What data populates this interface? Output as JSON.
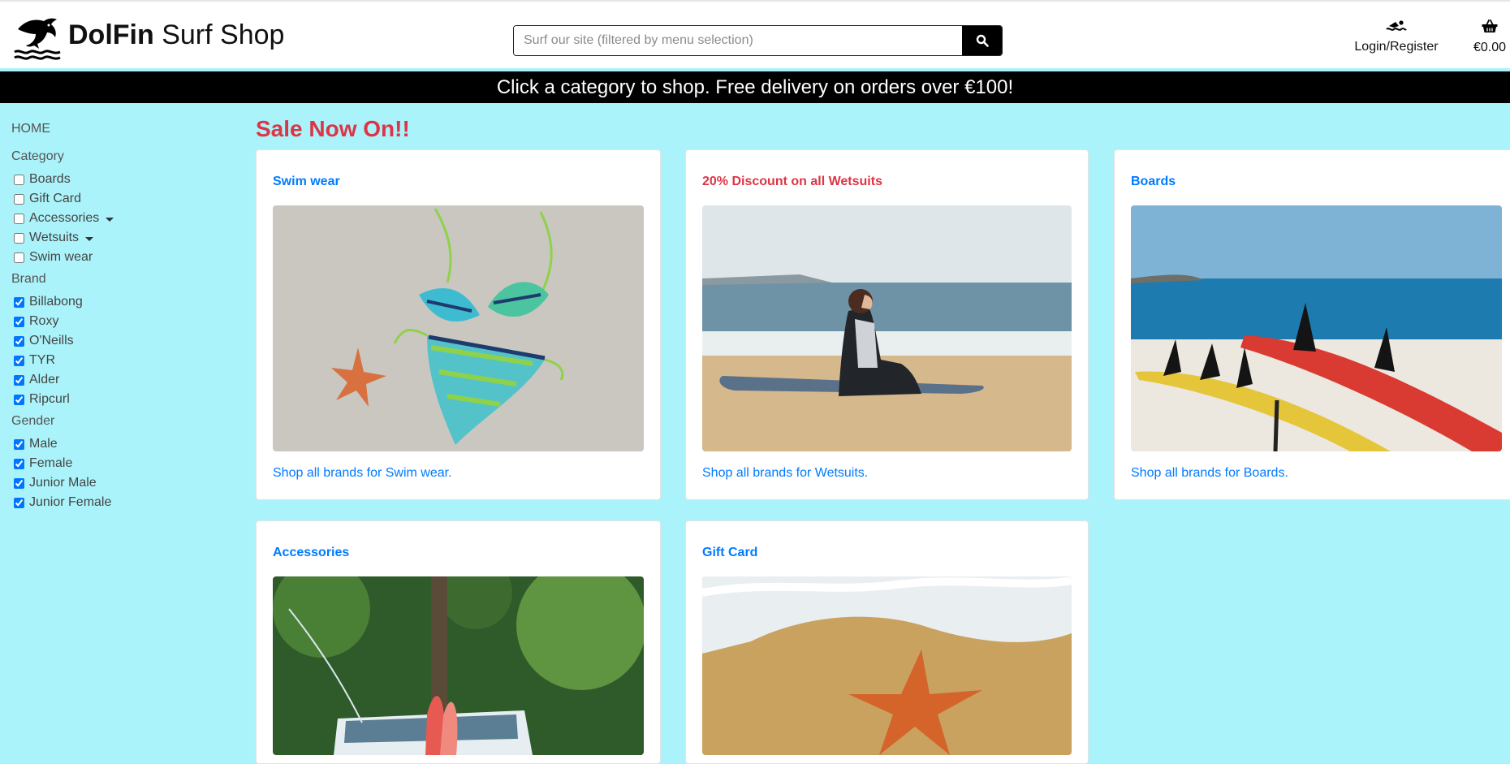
{
  "header": {
    "brand_bold": "DolFin",
    "brand_rest": " Surf Shop",
    "search_placeholder": "Surf our site (filtered by menu selection)",
    "account_label": "Login/Register",
    "cart_total": "€0.00"
  },
  "banner": {
    "text": "Click a category to shop. Free delivery on orders over €100!"
  },
  "sidebar": {
    "home": "HOME",
    "category_title": "Category",
    "categories": [
      {
        "label": "Boards",
        "checked": false
      },
      {
        "label": "Gift Card",
        "checked": false
      },
      {
        "label": "Accessories",
        "checked": false,
        "dropdown": true
      },
      {
        "label": "Wetsuits",
        "checked": false,
        "dropdown": true
      },
      {
        "label": "Swim wear",
        "checked": false
      }
    ],
    "brand_title": "Brand",
    "brands": [
      {
        "label": "Billabong",
        "checked": true
      },
      {
        "label": "Roxy",
        "checked": true
      },
      {
        "label": "O'Neills",
        "checked": true
      },
      {
        "label": "TYR",
        "checked": true
      },
      {
        "label": "Alder",
        "checked": true
      },
      {
        "label": "Ripcurl",
        "checked": true
      }
    ],
    "gender_title": "Gender",
    "genders": [
      {
        "label": "Male",
        "checked": true
      },
      {
        "label": "Female",
        "checked": true
      },
      {
        "label": "Junior Male",
        "checked": true
      },
      {
        "label": "Junior Female",
        "checked": true
      }
    ]
  },
  "main": {
    "sale_title": "Sale Now On!!",
    "cards": [
      {
        "title": "Swim wear",
        "link": "Shop all brands for Swim wear.",
        "highlight": false
      },
      {
        "title": "20% Discount on all Wetsuits",
        "link": "Shop all brands for Wetsuits.",
        "highlight": true
      },
      {
        "title": "Boards",
        "link": "Shop all brands for Boards.",
        "highlight": false
      },
      {
        "title": "Accessories",
        "link": "",
        "highlight": false
      },
      {
        "title": "Gift Card",
        "link": "",
        "highlight": false
      }
    ]
  },
  "colors": {
    "background": "#abf3fa",
    "accent_blue": "#007bff",
    "sale_red": "#dc3545",
    "banner_bg": "#000000"
  }
}
